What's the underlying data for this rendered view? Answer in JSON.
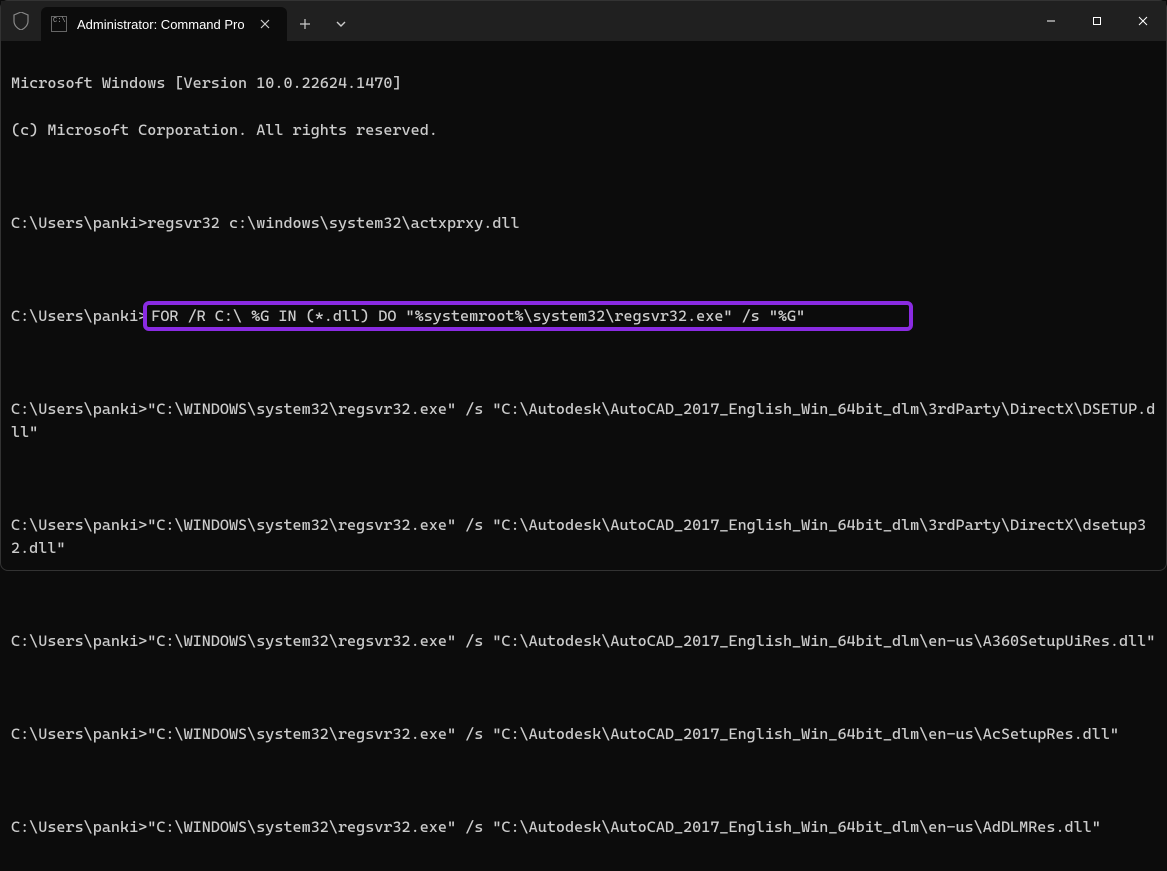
{
  "titlebar": {
    "tab_title": "Administrator: Command Pro",
    "tab_icon_text": "C:\\"
  },
  "prompt": "C:\\Users\\panki>",
  "terminal": {
    "banner_line1": "Microsoft Windows [Version 10.0.22624.1470]",
    "banner_line2": "(c) Microsoft Corporation. All rights reserved.",
    "cmd1": "regsvr32 c:\\windows\\system32\\actxprxy.dll",
    "cmd2": "FOR /R C:\\ %G IN (*.dll) DO \"%systemroot%\\system32\\regsvr32.exe\" /s \"%G\"",
    "out1": "\"C:\\WINDOWS\\system32\\regsvr32.exe\" /s \"C:\\Autodesk\\AutoCAD_2017_English_Win_64bit_dlm\\3rdParty\\DirectX\\DSETUP.dll\"",
    "out2": "\"C:\\WINDOWS\\system32\\regsvr32.exe\" /s \"C:\\Autodesk\\AutoCAD_2017_English_Win_64bit_dlm\\3rdParty\\DirectX\\dsetup32.dll\"",
    "out3": "\"C:\\WINDOWS\\system32\\regsvr32.exe\" /s \"C:\\Autodesk\\AutoCAD_2017_English_Win_64bit_dlm\\en-us\\A360SetupUiRes.dll\"",
    "out4": "\"C:\\WINDOWS\\system32\\regsvr32.exe\" /s \"C:\\Autodesk\\AutoCAD_2017_English_Win_64bit_dlm\\en-us\\AcSetupRes.dll\"",
    "out5": "\"C:\\WINDOWS\\system32\\regsvr32.exe\" /s \"C:\\Autodesk\\AutoCAD_2017_English_Win_64bit_dlm\\en-us\\AdDLMRes.dll\""
  }
}
